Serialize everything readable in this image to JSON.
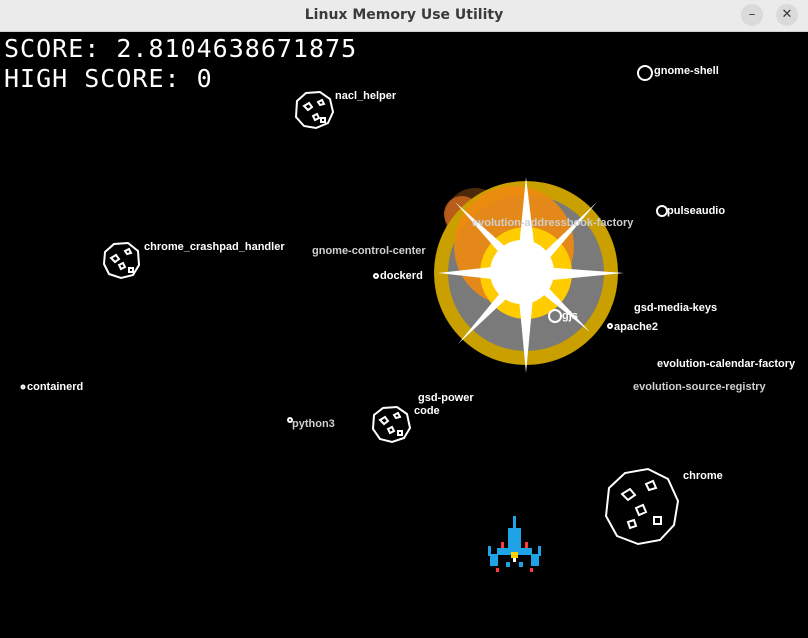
{
  "window": {
    "title": "Linux Memory Use Utility",
    "minimize_icon": "minimize-icon",
    "close_icon": "close-icon"
  },
  "hud": {
    "score_label": "SCORE: 2.8104638671875",
    "high_score_label": "HIGH SCORE: 0"
  },
  "asteroid_labels": {
    "nacl_helper": "nacl_helper",
    "chrome_crashpad_handler": "chrome_crashpad_handler",
    "code": "code",
    "chrome": "chrome",
    "gnome_shell": "gnome-shell",
    "pulseaudio": "pulseaudio",
    "evolution_addressbook_factory": "evolution-addressbook-factory",
    "gnome_control_center": "gnome-control-center",
    "dockerd": "dockerd",
    "gsd_media_keys": "gsd-media-keys",
    "gjs": "gjs",
    "apache2": "apache2",
    "evolution_calendar_factory": "evolution-calendar-factory",
    "evolution_source_registry": "evolution-source-registry",
    "containerd": "containerd",
    "gsd_power": "gsd-power",
    "python3": "python3"
  },
  "colors": {
    "background": "#000000",
    "asteroid_outline": "#ffffff",
    "explosion_outer": "#c9a000",
    "explosion_inner": "#ffcc00",
    "ship_body": "#1ea3e6"
  }
}
